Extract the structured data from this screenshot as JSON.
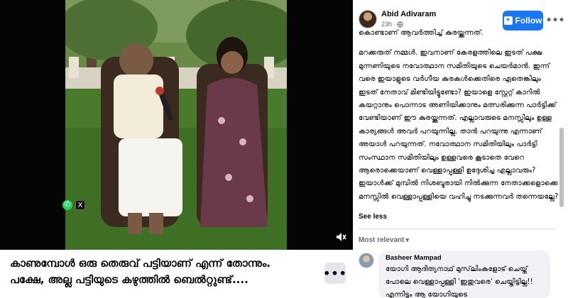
{
  "video": {
    "overlay_icons": [
      "whatsapp-icon",
      "x-icon"
    ],
    "mute_icon": "speaker-muted-icon"
  },
  "caption": {
    "line1": "കാണുമ്പോൾ ഒരു തെരുവ് പട്ടിയാണ് എന്ന് തോന്നും.",
    "line2": "പക്ഷേ, അല്ല പട്ടിയുടെ കഴുത്തിൽ ബെൽറ്റുണ്ട്....",
    "more_label": "•••"
  },
  "post": {
    "author": "Abid Adivaram",
    "time": "23h ·",
    "follow_label": "Follow",
    "more_label": "•••",
    "body_p1": "കൊണ്ടാണ് ആവർത്തിച്ച് കുരയ്ക്കുന്നത്.",
    "body_p2": "മറക്കരുത് നമ്മൾ. ഇവനാണ് കേരളത്തിലെ ഇടത് പക്ഷ മുന്നണിയുടെ നവോത്ഥാന സമിതിയുടെ ചെയർമാൻ. ഇന്ന് വരെ ഇയാളുടെ വർഗീയ കുരകൾക്കെതിരെ ഏതെങ്കിലും ഇടത് നേതാവ് മിണ്ടിയിട്ടുണ്ടോ? ഇയാളെ സ്റ്റേറ്റ് കാറിൽ കയറ്റാനും പൊന്നാട അണിയിക്കാനും മത്സരിക്കുന്ന പാർട്ടിക്ക് വേണ്ടിയാണ് ഈ കുരയ്ക്കുന്നത്. എല്ലാവരുടെ മനസ്സിലും ഉള്ള കാര്യങ്ങൾ അവർ പറയുന്നില്ല. താൻ പറയുന്നു എന്നാണ് അയാൾ പറയുന്നത്. നവോത്ഥാന സമിതിയിലും പാർട്ടി സംസ്ഥാന സമിതിയിലും ഉള്ളവരെ കൂടാതെ വേറെ ആരൊക്കെയാണ് വെള്ളാപ്പള്ളി ഉദ്ദേശിച്ച എല്ലാവരും? ഇയാൾക്ക് മുമ്പിൽ നിശബ്ദരായി നിൽക്കുന്ന നേതാക്കളൊക്കെ മനസ്സിൽ വെള്ളാപ്പള്ളിയെ വഹിച്ചു നടക്കുന്നവർ തന്നെയല്ലേ?",
    "see_less": "See less",
    "most_relevant": "Most relevant"
  },
  "comment": {
    "author": "Basheer Mampad",
    "text": "യോഗി ആദിത്യനാഥ് മുസ്‌ലിംകളോട് ചെയ്ത് പോലെ വെള്ളാപ്പള്ളി 'ഇതുവരെ' ചെയ്തിട്ടില്ല!! എന്നിട്ടും ആ യോഗിയുടെ"
  },
  "colors": {
    "follow_blue": "#1877f2",
    "comment_bubble": "#f0f2f5",
    "secondary_text": "#65676b"
  }
}
